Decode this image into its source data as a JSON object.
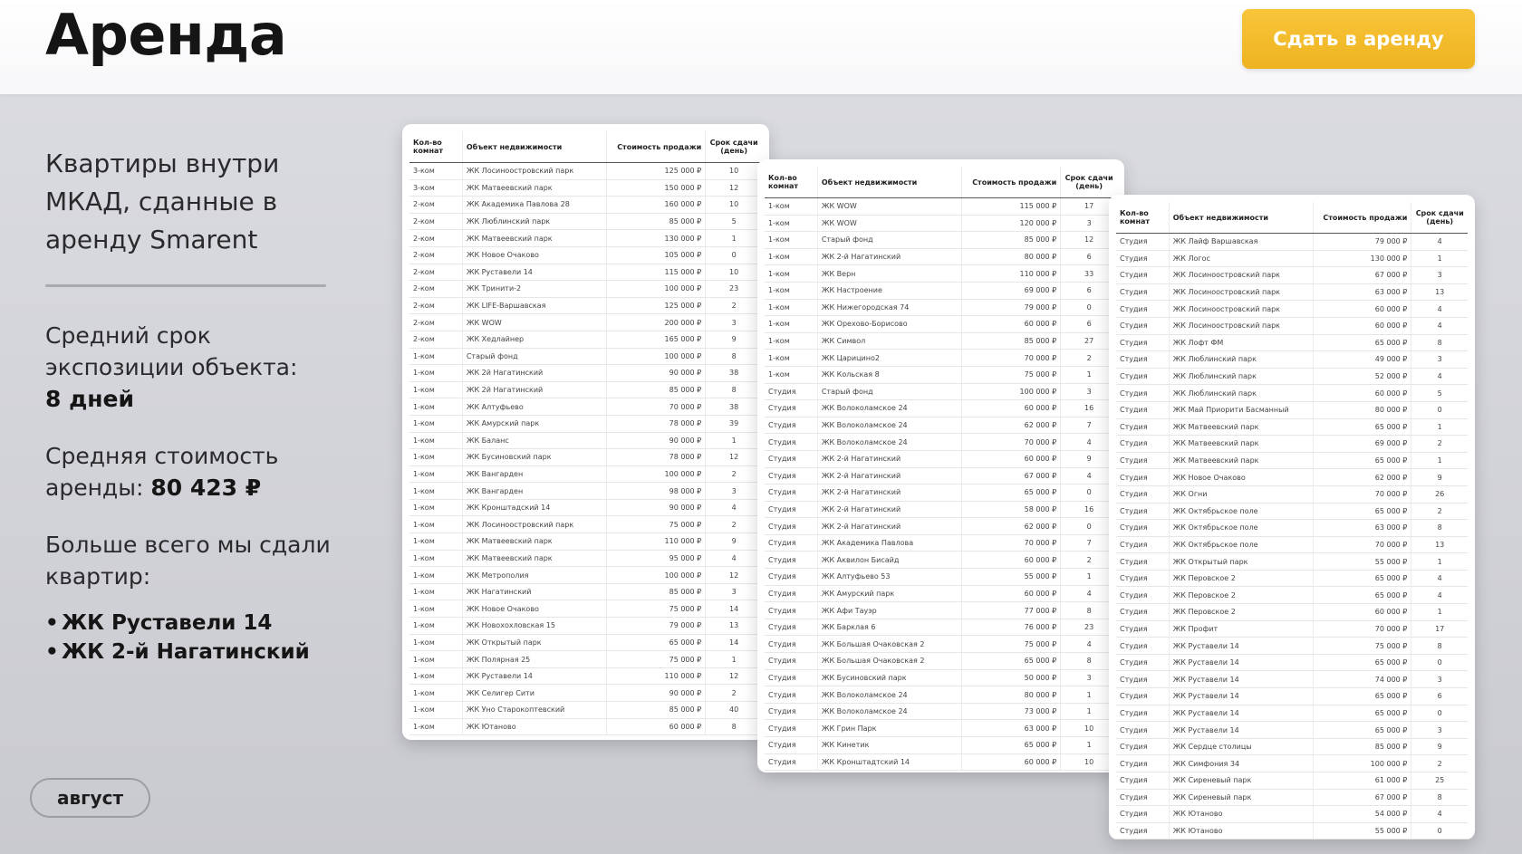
{
  "header": {
    "title": "Аренда",
    "rent_button": "Сдать в аренду"
  },
  "left": {
    "intro": "Квартиры внутри МКАД, сданные в аренду Smarent",
    "avg_term_label": "Средний срок экспозиции объекта:",
    "avg_term_value": "8 дней",
    "avg_price_label": "Средняя стоимость аренды:",
    "avg_price_value": "80 423 ₽",
    "most_label": "Больше всего мы сдали квартир:",
    "most_items": [
      "ЖК Руставели 14",
      "ЖК 2-й Нагатинский"
    ]
  },
  "month_chip": "август",
  "columns": {
    "rooms": "Кол-во комнат",
    "object": "Объект недвижимости",
    "price": "Стоимость продажи",
    "days": "Срок сдачи (день)"
  },
  "tables": [
    {
      "rows": [
        [
          "3-ком",
          "ЖК Лосиноостровский парк",
          "125 000 ₽",
          "10"
        ],
        [
          "3-ком",
          "ЖК Матвеевский парк",
          "150 000 ₽",
          "12"
        ],
        [
          "2-ком",
          "ЖК Академика Павлова 28",
          "160 000 ₽",
          "10"
        ],
        [
          "2-ком",
          "ЖК Люблинский парк",
          "85 000 ₽",
          "5"
        ],
        [
          "2-ком",
          "ЖК Матвеевский парк",
          "130 000 ₽",
          "1"
        ],
        [
          "2-ком",
          "ЖК Новое Очаково",
          "105 000 ₽",
          "0"
        ],
        [
          "2-ком",
          "ЖК Руставели 14",
          "115 000 ₽",
          "10"
        ],
        [
          "2-ком",
          "ЖК Тринити-2",
          "100 000 ₽",
          "23"
        ],
        [
          "2-ком",
          "ЖК LIFE-Варшавская",
          "125 000 ₽",
          "2"
        ],
        [
          "2-ком",
          "ЖК WOW",
          "200 000 ₽",
          "3"
        ],
        [
          "2-ком",
          "ЖК Хедлайнер",
          "165 000 ₽",
          "9"
        ],
        [
          "1-ком",
          "Старый фонд",
          "100 000 ₽",
          "8"
        ],
        [
          "1-ком",
          "ЖК 2й Нагатинский",
          "90 000 ₽",
          "38"
        ],
        [
          "1-ком",
          "ЖК 2й Нагатинский",
          "85 000 ₽",
          "8"
        ],
        [
          "1-ком",
          "ЖК Алтуфьево",
          "70 000 ₽",
          "38"
        ],
        [
          "1-ком",
          "ЖК Амурский парк",
          "78 000 ₽",
          "39"
        ],
        [
          "1-ком",
          "ЖК Баланс",
          "90 000 ₽",
          "1"
        ],
        [
          "1-ком",
          "ЖК Бусиновский парк",
          "78 000 ₽",
          "12"
        ],
        [
          "1-ком",
          "ЖК Вангарден",
          "100 000 ₽",
          "2"
        ],
        [
          "1-ком",
          "ЖК Вангарден",
          "98 000 ₽",
          "3"
        ],
        [
          "1-ком",
          "ЖК Кронштадский 14",
          "90 000 ₽",
          "4"
        ],
        [
          "1-ком",
          "ЖК Лосиноостровский парк",
          "75 000 ₽",
          "2"
        ],
        [
          "1-ком",
          "ЖК Матвеевский парк",
          "110 000 ₽",
          "9"
        ],
        [
          "1-ком",
          "ЖК Матвеевский парк",
          "95 000 ₽",
          "4"
        ],
        [
          "1-ком",
          "ЖК Метрополия",
          "100 000 ₽",
          "12"
        ],
        [
          "1-ком",
          "ЖК Нагатинский",
          "85 000 ₽",
          "3"
        ],
        [
          "1-ком",
          "ЖК Новое Очаково",
          "75 000 ₽",
          "14"
        ],
        [
          "1-ком",
          "ЖК Новохохловская 15",
          "79 000 ₽",
          "13"
        ],
        [
          "1-ком",
          "ЖК Открытый парк",
          "65 000 ₽",
          "14"
        ],
        [
          "1-ком",
          "ЖК Полярная 25",
          "75 000 ₽",
          "1"
        ],
        [
          "1-ком",
          "ЖК Руставели 14",
          "110 000 ₽",
          "12"
        ],
        [
          "1-ком",
          "ЖК Селигер Сити",
          "90 000 ₽",
          "2"
        ],
        [
          "1-ком",
          "ЖК Уно Старокоптевский",
          "85 000 ₽",
          "40"
        ],
        [
          "1-ком",
          "ЖК Ютаново",
          "60 000 ₽",
          "8"
        ]
      ]
    },
    {
      "rows": [
        [
          "1-ком",
          "ЖК WOW",
          "115 000 ₽",
          "17"
        ],
        [
          "1-ком",
          "ЖК WOW",
          "120 000 ₽",
          "3"
        ],
        [
          "1-ком",
          "Старый фонд",
          "85 000 ₽",
          "12"
        ],
        [
          "1-ком",
          "ЖК 2-й Нагатинский",
          "80 000 ₽",
          "6"
        ],
        [
          "1-ком",
          "ЖК Верн",
          "110 000 ₽",
          "33"
        ],
        [
          "1-ком",
          "ЖК Настроение",
          "69 000 ₽",
          "6"
        ],
        [
          "1-ком",
          "ЖК Нижегородская 74",
          "79 000 ₽",
          "0"
        ],
        [
          "1-ком",
          "ЖК Орехово-Борисово",
          "60 000 ₽",
          "6"
        ],
        [
          "1-ком",
          "ЖК Символ",
          "85 000 ₽",
          "27"
        ],
        [
          "1-ком",
          "ЖК Царицино2",
          "70 000 ₽",
          "2"
        ],
        [
          "1-ком",
          "ЖК Кольская 8",
          "75 000 ₽",
          "1"
        ],
        [
          "Студия",
          "Старый фонд",
          "100 000 ₽",
          "3"
        ],
        [
          "Студия",
          "ЖК Волоколамское 24",
          "60 000 ₽",
          "16"
        ],
        [
          "Студия",
          "ЖК Волоколамское 24",
          "62 000 ₽",
          "7"
        ],
        [
          "Студия",
          "ЖК Волоколамское 24",
          "70 000 ₽",
          "4"
        ],
        [
          "Студия",
          "ЖК 2-й Нагатинский",
          "60 000 ₽",
          "9"
        ],
        [
          "Студия",
          "ЖК 2-й Нагатинский",
          "67 000 ₽",
          "4"
        ],
        [
          "Студия",
          "ЖК 2-й Нагатинский",
          "65 000 ₽",
          "0"
        ],
        [
          "Студия",
          "ЖК 2-й Нагатинский",
          "58 000 ₽",
          "16"
        ],
        [
          "Студия",
          "ЖК 2-й Нагатинский",
          "62 000 ₽",
          "0"
        ],
        [
          "Студия",
          "ЖК Академика Павлова",
          "70 000 ₽",
          "7"
        ],
        [
          "Студия",
          "ЖК Аквилон Бисайд",
          "60 000 ₽",
          "2"
        ],
        [
          "Студия",
          "ЖК Алтуфьево 53",
          "55 000 ₽",
          "1"
        ],
        [
          "Студия",
          "ЖК Амурский парк",
          "60 000 ₽",
          "4"
        ],
        [
          "Студия",
          "ЖК Афи Тауэр",
          "77 000 ₽",
          "8"
        ],
        [
          "Студия",
          "ЖК Барклая 6",
          "76 000 ₽",
          "23"
        ],
        [
          "Студия",
          "ЖК Большая Очаковская 2",
          "75 000 ₽",
          "4"
        ],
        [
          "Студия",
          "ЖК Большая Очаковская 2",
          "65 000 ₽",
          "8"
        ],
        [
          "Студия",
          "ЖК Бусиновский парк",
          "50 000 ₽",
          "3"
        ],
        [
          "Студия",
          "ЖК Волоколамское 24",
          "80 000 ₽",
          "1"
        ],
        [
          "Студия",
          "ЖК Волоколамское 24",
          "73 000 ₽",
          "1"
        ],
        [
          "Студия",
          "ЖК Грин Парк",
          "63 000 ₽",
          "10"
        ],
        [
          "Студия",
          "ЖК Кинетик",
          "65 000 ₽",
          "1"
        ],
        [
          "Студия",
          "ЖК Кронштадтский 14",
          "60 000 ₽",
          "10"
        ]
      ]
    },
    {
      "rows": [
        [
          "Студия",
          "ЖК Лайф Варшавская",
          "79 000 ₽",
          "4"
        ],
        [
          "Студия",
          "ЖК Логос",
          "130 000 ₽",
          "1"
        ],
        [
          "Студия",
          "ЖК Лосиноостровский парк",
          "67 000 ₽",
          "3"
        ],
        [
          "Студия",
          "ЖК Лосиноостровский парк",
          "63 000 ₽",
          "13"
        ],
        [
          "Студия",
          "ЖК Лосиноостровский парк",
          "60 000 ₽",
          "4"
        ],
        [
          "Студия",
          "ЖК Лосиноостровский парк",
          "60 000 ₽",
          "4"
        ],
        [
          "Студия",
          "ЖК Лофт ФМ",
          "65 000 ₽",
          "8"
        ],
        [
          "Студия",
          "ЖК Люблинский парк",
          "49 000 ₽",
          "3"
        ],
        [
          "Студия",
          "ЖК Люблинский парк",
          "52 000 ₽",
          "4"
        ],
        [
          "Студия",
          "ЖК Люблинский парк",
          "60 000 ₽",
          "5"
        ],
        [
          "Студия",
          "ЖК Май Приорити Басманный",
          "80 000 ₽",
          "0"
        ],
        [
          "Студия",
          "ЖК Матвеевский парк",
          "65 000 ₽",
          "1"
        ],
        [
          "Студия",
          "ЖК Матвеевский парк",
          "69 000 ₽",
          "2"
        ],
        [
          "Студия",
          "ЖК Матвеевский парк",
          "65 000 ₽",
          "1"
        ],
        [
          "Студия",
          "ЖК Новое Очаково",
          "62 000 ₽",
          "9"
        ],
        [
          "Студия",
          "ЖК Огни",
          "70 000 ₽",
          "26"
        ],
        [
          "Студия",
          "ЖК Октябрьское поле",
          "65 000 ₽",
          "2"
        ],
        [
          "Студия",
          "ЖК Октябрьское поле",
          "63 000 ₽",
          "8"
        ],
        [
          "Студия",
          "ЖК Октябрьское поле",
          "70 000 ₽",
          "13"
        ],
        [
          "Студия",
          "ЖК Открытый парк",
          "55 000 ₽",
          "1"
        ],
        [
          "Студия",
          "ЖК Перовское 2",
          "65 000 ₽",
          "4"
        ],
        [
          "Студия",
          "ЖК Перовское 2",
          "65 000 ₽",
          "4"
        ],
        [
          "Студия",
          "ЖК Перовское 2",
          "60 000 ₽",
          "1"
        ],
        [
          "Студия",
          "ЖК Профит",
          "70 000 ₽",
          "17"
        ],
        [
          "Студия",
          "ЖК Руставели 14",
          "75 000 ₽",
          "8"
        ],
        [
          "Студия",
          "ЖК Руставели 14",
          "65 000 ₽",
          "0"
        ],
        [
          "Студия",
          "ЖК Руставели 14",
          "74 000 ₽",
          "3"
        ],
        [
          "Студия",
          "ЖК Руставели 14",
          "65 000 ₽",
          "6"
        ],
        [
          "Студия",
          "ЖК Руставели 14",
          "65 000 ₽",
          "0"
        ],
        [
          "Студия",
          "ЖК Руставели 14",
          "65 000 ₽",
          "3"
        ],
        [
          "Студия",
          "ЖК Сердце столицы",
          "85 000 ₽",
          "9"
        ],
        [
          "Студия",
          "ЖК Симфония 34",
          "100 000 ₽",
          "2"
        ],
        [
          "Студия",
          "ЖК Сиреневый парк",
          "61 000 ₽",
          "25"
        ],
        [
          "Студия",
          "ЖК Сиреневый парк",
          "67 000 ₽",
          "8"
        ],
        [
          "Студия",
          "ЖК Ютаново",
          "54 000 ₽",
          "4"
        ],
        [
          "Студия",
          "ЖК Ютаново",
          "55 000 ₽",
          "0"
        ]
      ]
    }
  ]
}
